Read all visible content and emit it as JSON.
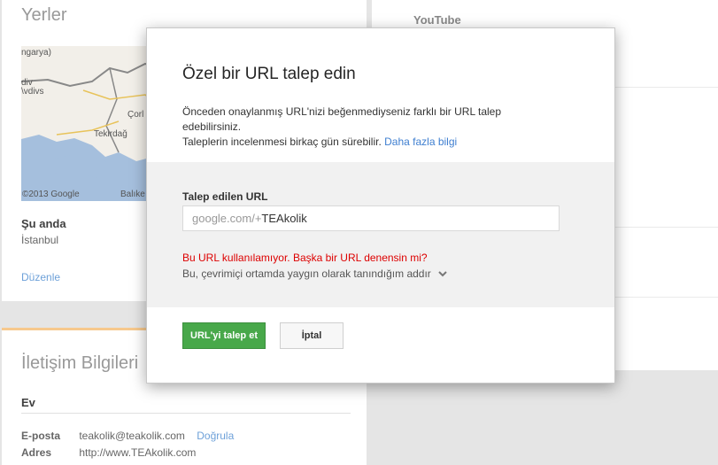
{
  "places": {
    "title": "Yerler",
    "map": {
      "copyright": "©2013 Google",
      "labels": [
        "ngarya)",
        "div",
        "\\vdivs",
        "Çorl",
        "Tekirdağ",
        "Balıke"
      ]
    },
    "now_label": "Şu anda",
    "now_value": "İstanbul",
    "edit_link": "Düzenle"
  },
  "contact": {
    "title": "İletişim Bilgileri",
    "home_label": "Ev",
    "rows": [
      {
        "label": "E-posta",
        "value": "teakolik@teakolik.com",
        "link": "Doğrula"
      },
      {
        "label": "Adres",
        "value": "http://www.TEAkolik.com"
      }
    ]
  },
  "right": {
    "youtube_title": "YouTube"
  },
  "dialog": {
    "title": "Özel bir URL talep edin",
    "desc_line1": "Önceden onaylanmış URL'nizi beğenmediyseniz farklı bir URL talep edebilirsiniz.",
    "desc_line2": "Taleplerin incelenmesi birkaç gün sürebilir.",
    "more_info_link": "Daha fazla bilgi",
    "url_label": "Talep edilen URL",
    "url_prefix": "google.com/+",
    "url_value": "TEAkolik",
    "error_text": "Bu URL kullanılamıyor. Başka bir URL denensin mi?",
    "reason_select": "Bu, çevrimiçi ortamda yaygın olarak tanındığım addır",
    "submit_label": "URL'yi talep et",
    "cancel_label": "İptal"
  },
  "colors": {
    "accent_green": "#48a84a",
    "error_red": "#dd0000",
    "link_blue": "#3f7fd0",
    "contact_accent": "#f7c98d"
  }
}
